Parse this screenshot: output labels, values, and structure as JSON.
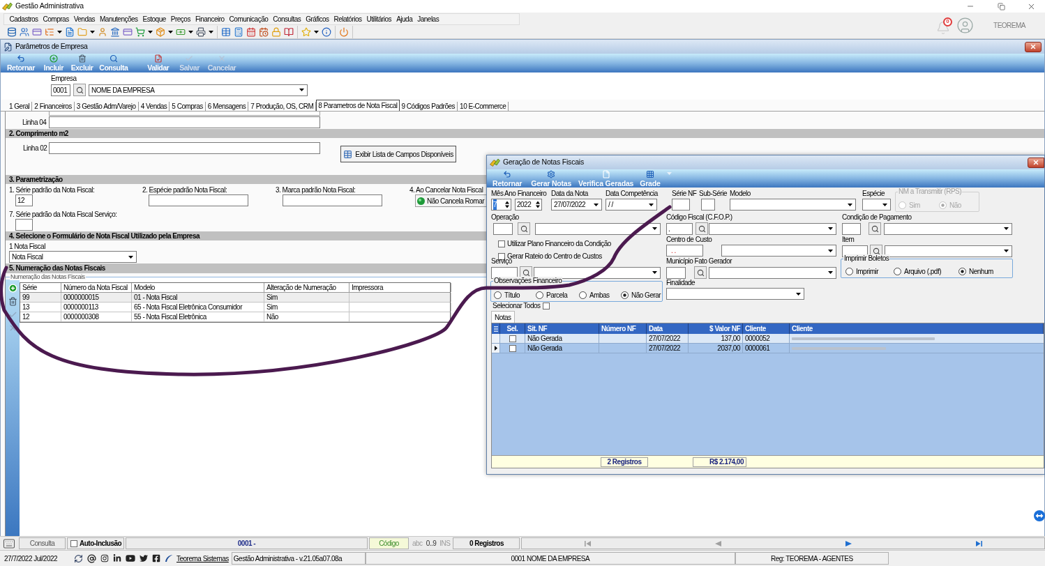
{
  "app": {
    "title": "Gestão Administrativa",
    "menu": [
      "Cadastros",
      "Compras",
      "Vendas",
      "Manutenções",
      "Estoque",
      "Preços",
      "Financeiro",
      "Comunicação",
      "Consultas",
      "Gráficos",
      "Relatórios",
      "Utilitários",
      "Ajuda",
      "Janelas"
    ],
    "notification_count": "0",
    "user": "TEOREMA"
  },
  "window": {
    "title": "Parâmetros de Empresa",
    "toolbar": [
      {
        "label": "Retornar",
        "disabled": false
      },
      {
        "label": "Incluir",
        "disabled": false
      },
      {
        "label": "Excluir",
        "disabled": false
      },
      {
        "label": "Consulta",
        "disabled": false
      },
      {
        "label": "Validar",
        "disabled": false
      },
      {
        "label": "Salvar",
        "disabled": true
      },
      {
        "label": "Cancelar",
        "disabled": true
      }
    ],
    "empresa": {
      "label": "Empresa",
      "code": "0001",
      "name": "NOME DA EMPRESA"
    },
    "tabs": [
      {
        "label": "1 Geral",
        "selected": false
      },
      {
        "label": "2 Financeiros",
        "selected": false
      },
      {
        "label": "3 Gestão Adm/Varejo",
        "selected": false
      },
      {
        "label": "4 Vendas",
        "selected": false
      },
      {
        "label": "5 Compras",
        "selected": false
      },
      {
        "label": "6 Mensagens",
        "selected": false
      },
      {
        "label": "7 Produção, OS, CRM",
        "selected": false
      },
      {
        "label": "8 Parametros de Nota Fiscal",
        "selected": true
      },
      {
        "label": "9 Códigos Padrões",
        "selected": false
      },
      {
        "label": "10 E-Commerce",
        "selected": false
      }
    ],
    "linha_04": {
      "label": "Linha 04"
    },
    "comprimento": {
      "title": "2. Comprimento m2",
      "label": "Linha 02",
      "button": "Exibir Lista de Campos Disponíveis"
    },
    "parametrizacao": {
      "title": "3. Parametrização",
      "fields": [
        {
          "kind": "input",
          "label": "1. Série padrão da Nota Fiscal:",
          "value": "12"
        },
        {
          "kind": "input",
          "label": "2. Espécie padrão Nota Fiscal:"
        },
        {
          "kind": "input",
          "label": "3. Marca padrão Nota Fiscal:"
        },
        {
          "kind": "button",
          "label": "4. Ao Cancelar Nota Fiscal",
          "value": "Não Cancela Romar"
        }
      ],
      "service_field": {
        "label": "7. Série padrão da Nota Fiscal Serviço:"
      }
    },
    "formulario": {
      "title": "4. Selecione o Formulário de Nota Fiscal Utilizado pela Empresa",
      "label": "1 Nota Fiscal",
      "value": "Nota Fiscal"
    },
    "numeracao": {
      "title": "5. Numeração das Notas Fiscais",
      "group": "Numeração das Notas Fiscais",
      "columns": [
        "Série",
        "Número da Nota Fiscal",
        "Modelo",
        "Alteração de Numeração",
        "Impressora"
      ],
      "rows": [
        {
          "selected": true,
          "cells": [
            "99",
            "0000000015",
            "01 - Nota Fiscal",
            "Sim"
          ]
        },
        {
          "selected": false,
          "cells": [
            "13",
            "0000000113",
            "65 - Nota Fiscal Eletrônica Consumidor",
            "Sim"
          ]
        },
        {
          "selected": false,
          "cells": [
            "12",
            "0000000308",
            "55 - Nota Fiscal Eletrônica",
            "Não"
          ]
        }
      ]
    }
  },
  "dialog": {
    "title": "Geração de Notas Fiscais",
    "toolbar": [
      {
        "label": "Retornar",
        "has_menu": false
      },
      {
        "label": "Gerar Notas",
        "has_menu": false
      },
      {
        "label": "Verifica Geradas",
        "has_menu": false
      },
      {
        "label": "Grade",
        "has_menu": true
      }
    ],
    "mes_ano": {
      "label": "Mês Ano Financeiro",
      "month": "7",
      "year": "2022",
      "focused": true
    },
    "data_nota": {
      "label": "Data da Nota",
      "value": "27/07/2022"
    },
    "data_competencia": {
      "label": "Data Competência",
      "value": "/ /"
    },
    "serie_nf": {
      "label": "Série NF"
    },
    "sub_serie": {
      "label": "Sub-Série"
    },
    "modelo": {
      "label": "Modelo"
    },
    "especie": {
      "label": "Espécie"
    },
    "rps": {
      "title": "NM a Transmitir (RPS)",
      "disabled": true,
      "options": [
        {
          "label": "Sim",
          "selected": false
        },
        {
          "label": "Não",
          "selected": true
        }
      ]
    },
    "operacao": {
      "label": "Operação"
    },
    "cfop": {
      "label": "Código Fiscal (C.F.O.P.)",
      "value": "."
    },
    "condicao": {
      "label": "Condição de Pagamento"
    },
    "options": [
      {
        "label": "Utilizar Plano Financeiro da Condição",
        "checked": false
      },
      {
        "label": "Gerar Rateio do Centro de Custos",
        "checked": false
      }
    ],
    "centro_custo": {
      "label": "Centro de Custo",
      "value": ". ."
    },
    "item": {
      "label": "Item"
    },
    "servico": {
      "label": "Serviço"
    },
    "municipio": {
      "label": "Município Fato Gerador"
    },
    "boletos": {
      "title": "Imprimir Boletos",
      "options": [
        {
          "label": "Imprimir",
          "selected": false
        },
        {
          "label": "Arquivo (.pdf)",
          "selected": false
        },
        {
          "label": "Nenhum",
          "selected": true
        }
      ]
    },
    "observacoes": {
      "title": "Observações Financeiro",
      "options": [
        {
          "label": "Título",
          "selected": false
        },
        {
          "label": "Parcela",
          "selected": false
        },
        {
          "label": "Ambas",
          "selected": false
        },
        {
          "label": "Não Gerar",
          "selected": true
        }
      ]
    },
    "finalidade": {
      "label": "Finalidade"
    },
    "select_all": {
      "label": "Selecionar Todos",
      "checked": false
    },
    "tabs": [
      {
        "label": "Notas",
        "selected": true
      }
    ],
    "grid": {
      "columns": [
        "Sel.",
        "Sit. NF",
        "Número NF",
        "Data",
        "$ Valor NF",
        "Cliente",
        "Cliente"
      ],
      "rows": [
        {
          "selected": false,
          "checked": false,
          "status": "Não Gerada",
          "date": "27/07/2022",
          "value": "137,00",
          "client_code": "0000052",
          "client_name_redacted": true
        },
        {
          "selected": true,
          "checked": false,
          "status": "Não Gerada",
          "date": "27/07/2022",
          "value": "2037,00",
          "client_code": "0000061",
          "client_name_redacted": true
        }
      ],
      "count": "2 Registros",
      "total": "R$ 2.174,00"
    }
  },
  "status_bar": {
    "mode": "Consulta",
    "auto_inclusion": {
      "label": "Auto-Inclusão",
      "checked": false
    },
    "record": "0001 -",
    "code_button": "Código",
    "indicators": [
      {
        "label": "abc",
        "active": false
      },
      {
        "label": "0..9",
        "active": true
      },
      {
        "label": "INS",
        "active": false
      }
    ],
    "records": "0 Registros",
    "navigation": [
      {
        "disabled": true
      },
      {
        "disabled": true
      },
      {
        "disabled": false
      },
      {
        "disabled": false
      }
    ]
  },
  "footer_bar": {
    "date": "27/7/2022 Jul/2022",
    "link": "Teorema Sistemas",
    "version": "Gestão Administrativa - v.21.05a07.08a",
    "company": "0001 NOME DA EMPRESA",
    "registration": "Reg: TEOREMA - AGENTES"
  }
}
